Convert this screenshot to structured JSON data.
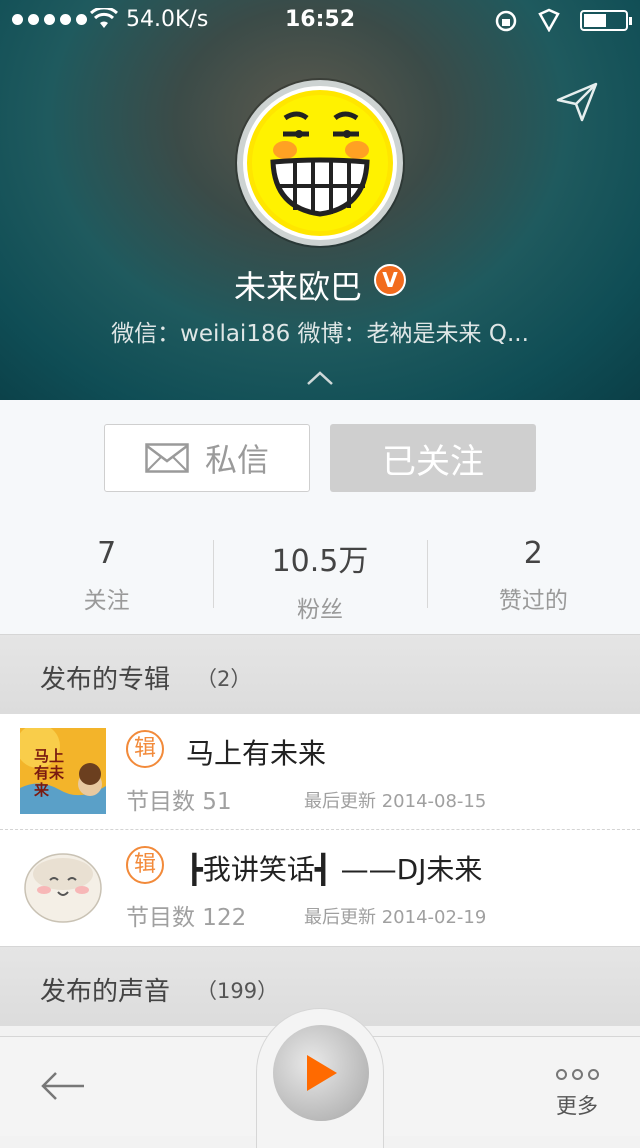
{
  "status_bar": {
    "speed": "54.0K/s",
    "time": "16:52"
  },
  "profile": {
    "name": "未来欧巴",
    "verified_badge": "V",
    "subinfo": "微信：weilai186 微博：老衲是未来 Q..."
  },
  "actions": {
    "message_label": "私信",
    "follow_label": "已关注"
  },
  "stats": [
    {
      "num": "7",
      "label": "关注"
    },
    {
      "num": "10.5万",
      "label": "粉丝"
    },
    {
      "num": "2",
      "label": "赞过的"
    }
  ],
  "albums_section": {
    "title": "发布的专辑",
    "count": "（2）"
  },
  "albums": [
    {
      "tag": "辑",
      "title": "马上有未来",
      "episodes": "节目数 51",
      "updated": "最后更新 2014-08-15",
      "thumb_text": "马上有未来"
    },
    {
      "tag": "辑",
      "title": "┣我讲笑话┫ ——DJ未来",
      "episodes": "节目数 122",
      "updated": "最后更新 2014-02-19"
    }
  ],
  "sounds_section": {
    "title": "发布的声音",
    "count": "（199）"
  },
  "bottom": {
    "more_label": "更多"
  },
  "colors": {
    "accent": "#f28a3a",
    "header_teal": "#0f4d55",
    "follow_bg": "#cfcfcf",
    "play": "#ff6a00"
  }
}
